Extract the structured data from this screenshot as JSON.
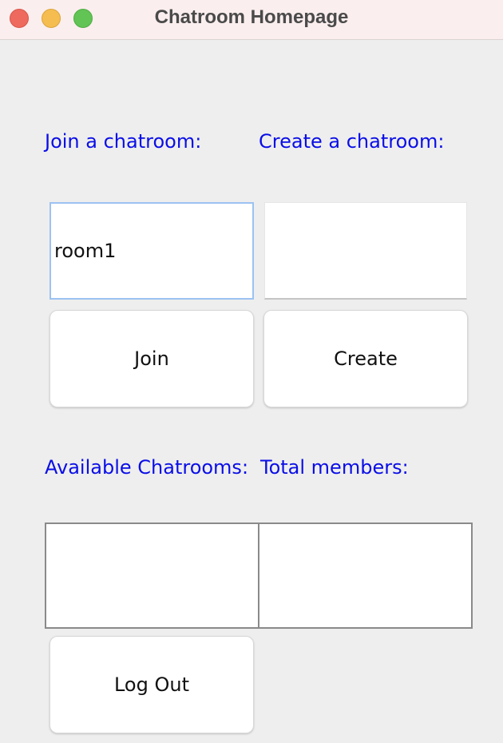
{
  "window": {
    "title": "Chatroom Homepage"
  },
  "join": {
    "label": "Join a chatroom:",
    "input_value": "room1",
    "button_label": "Join"
  },
  "create": {
    "label": "Create a chatroom:",
    "input_value": "",
    "button_label": "Create"
  },
  "available": {
    "label": "Available Chatrooms:",
    "items": []
  },
  "members": {
    "label": "Total members:",
    "items": []
  },
  "logout": {
    "button_label": "Log Out"
  }
}
